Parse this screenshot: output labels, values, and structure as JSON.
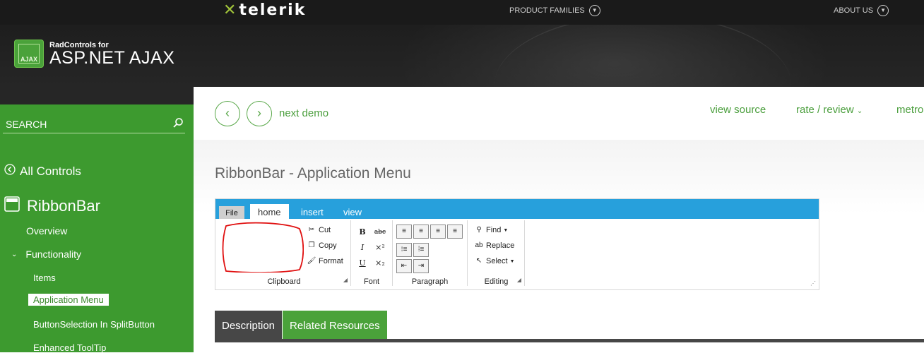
{
  "header": {
    "logo": "telerik",
    "nav": [
      {
        "label": "PRODUCT FAMILIES"
      },
      {
        "label": "ABOUT US"
      }
    ],
    "product_small": "RadControls for",
    "product_big": "ASP.NET AJAX",
    "product_icon_text": "AJAX"
  },
  "sidebar": {
    "search_label": "SEARCH",
    "all_controls": "All Controls",
    "control": "RibbonBar",
    "overview": "Overview",
    "functionality": "Functionality",
    "sub_items": [
      "Items",
      "Application Menu",
      "ButtonSelection In SplitButton",
      "Enhanced ToolTip"
    ]
  },
  "toolbar": {
    "next_demo": "next demo",
    "view_source": "view source",
    "rate_review": "rate / review",
    "metro": "metro"
  },
  "main": {
    "title": "RibbonBar - Application Menu",
    "tabs": [
      "Description",
      "Related Resources"
    ]
  },
  "ribbon": {
    "file_tab": "File",
    "tabs": [
      "home",
      "insert",
      "view"
    ],
    "clipboard": {
      "label": "Clipboard",
      "buttons": [
        "Cut",
        "Copy",
        "Format"
      ]
    },
    "font": {
      "label": "Font"
    },
    "paragraph": {
      "label": "Paragraph"
    },
    "editing": {
      "label": "Editing",
      "buttons": [
        "Find",
        "Replace",
        "Select"
      ]
    }
  },
  "colors": {
    "green": "#3d9a2f",
    "blue": "#27a0dc",
    "dark": "#262626"
  }
}
